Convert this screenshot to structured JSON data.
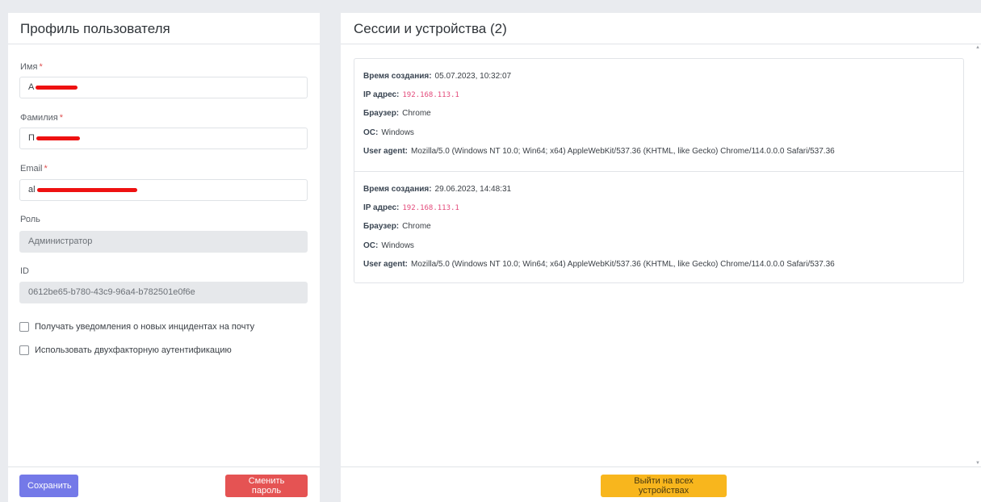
{
  "profile": {
    "title": "Профиль пользователя",
    "first_name": {
      "label": "Имя",
      "required_mark": "*",
      "value": "А"
    },
    "last_name": {
      "label": "Фамилия",
      "required_mark": "*",
      "value": "П"
    },
    "email": {
      "label": "Email",
      "required_mark": "*",
      "value": "al"
    },
    "role": {
      "label": "Роль",
      "value": "Администратор"
    },
    "id": {
      "label": "ID",
      "value": "0612be65-b780-43c9-96a4-b782501e0f6e"
    },
    "checkboxes": [
      {
        "label": "Получать уведомления о новых инцидентах на почту",
        "checked": false
      },
      {
        "label": "Использовать двухфакторную аутентификацию",
        "checked": false
      }
    ],
    "save_label": "Сохранить",
    "change_password_label": "Сменить пароль"
  },
  "sessions": {
    "title": "Сессии и устройства (2)",
    "labels": {
      "created": "Время создания:",
      "ip": "IP адрес:",
      "browser": "Браузер:",
      "os": "ОС:",
      "user_agent": "User agent:"
    },
    "items": [
      {
        "created": "05.07.2023, 10:32:07",
        "ip": "192.168.113.1",
        "browser": "Chrome",
        "os": "Windows",
        "user_agent": "Mozilla/5.0 (Windows NT 10.0; Win64; x64) AppleWebKit/537.36 (KHTML, like Gecko) Chrome/114.0.0.0 Safari/537.36"
      },
      {
        "created": "29.06.2023, 14:48:31",
        "ip": "192.168.113.1",
        "browser": "Chrome",
        "os": "Windows",
        "user_agent": "Mozilla/5.0 (Windows NT 10.0; Win64; x64) AppleWebKit/537.36 (KHTML, like Gecko) Chrome/114.0.0.0 Safari/537.36"
      }
    ],
    "logout_all_label": "Выйти на всех устройствах"
  },
  "colors": {
    "primary": "#7479e8",
    "danger": "#e55353",
    "warning": "#f8b61d",
    "required": "#e05252",
    "code": "#e3497a"
  }
}
